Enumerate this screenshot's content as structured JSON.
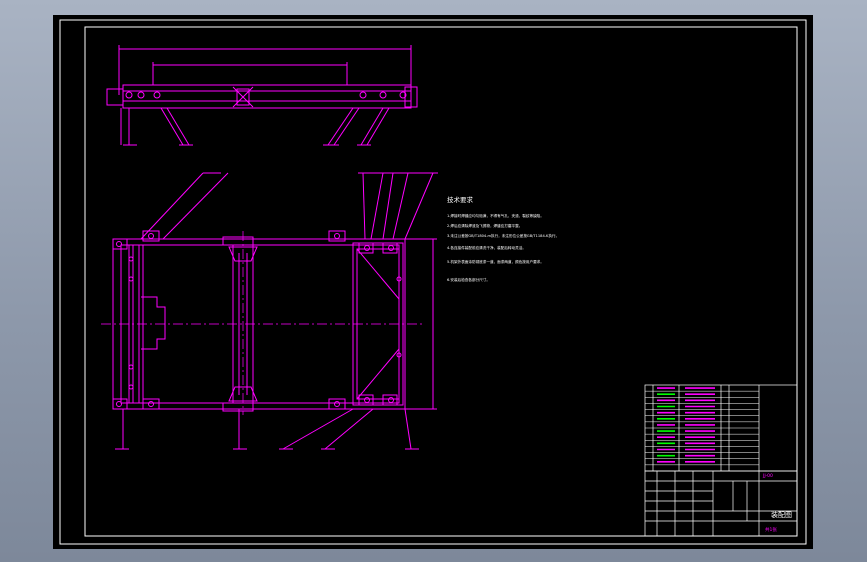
{
  "colors": {
    "background": "#000000",
    "border": "#ffffff",
    "geometry": "#ff00ff",
    "text": "#ffffff",
    "table_text": "#ff00ff",
    "green": "#00ff00"
  },
  "notes": {
    "heading": "技术要求",
    "items": [
      "1.焊接时焊缝应均匀饱满，不得有气孔、夹渣、裂纹等缺陷。",
      "2.焊后应清除焊渣及飞溅物，焊缝应打磨平整。",
      "3.未注公差按GB/T1804-m执行，未注形位公差按GB/T1184-K执行。",
      "4.各连接件装配前应清洗干净，装配后转动灵活。",
      "5.机架外表面涂防锈底漆一道，面漆两道，颜色按用户要求。",
      "6.安装后检查各部分尺寸。"
    ]
  },
  "title_block": {
    "drawing_title": "装配图",
    "drawing_number": "JJ-00",
    "sheet": "共1张"
  }
}
